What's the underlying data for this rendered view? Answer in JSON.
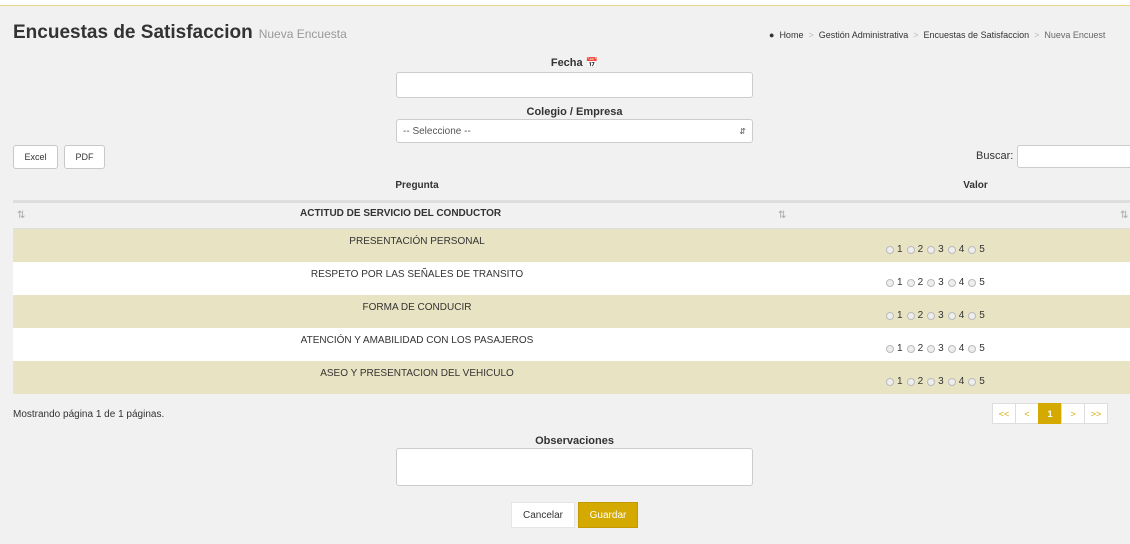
{
  "header": {
    "title": "Encuestas de Satisfaccion",
    "subtitle": "Nueva Encuesta",
    "breadcrumb": [
      "Home",
      "Gestión Administrativa",
      "Encuestas de Satisfaccion",
      "Nueva Encuest"
    ]
  },
  "form": {
    "fecha_label": "Fecha",
    "fecha_value": "",
    "colegio_label": "Colegio / Empresa",
    "colegio_selected": "-- Seleccione --",
    "observaciones_label": "Observaciones",
    "observaciones_value": ""
  },
  "toolbar": {
    "excel_label": "Excel",
    "pdf_label": "PDF",
    "search_label": "Buscar:",
    "search_value": ""
  },
  "table": {
    "columns": [
      "Pregunta",
      "Valor"
    ],
    "group": "ACTITUD DE SERVICIO DEL CONDUCTOR",
    "rows": [
      {
        "question": "PRESENTACIÓN PERSONAL"
      },
      {
        "question": "RESPETO POR LAS SEÑALES DE TRANSITO"
      },
      {
        "question": "FORMA DE CONDUCIR"
      },
      {
        "question": "ATENCIÓN Y AMABILIDAD CON LOS PASAJEROS"
      },
      {
        "question": "ASEO Y PRESENTACION DEL VEHICULO"
      }
    ],
    "rating_options": [
      "1",
      "2",
      "3",
      "4",
      "5"
    ]
  },
  "pagination": {
    "info": "Mostrando página 1 de 1 páginas.",
    "first": "<<",
    "prev": "<",
    "current": "1",
    "next": ">",
    "last": ">>"
  },
  "actions": {
    "cancel_label": "Cancelar",
    "save_label": "Guardar"
  },
  "colors": {
    "accent": "#d4a900",
    "row_highlight": "#e8e3c3"
  }
}
